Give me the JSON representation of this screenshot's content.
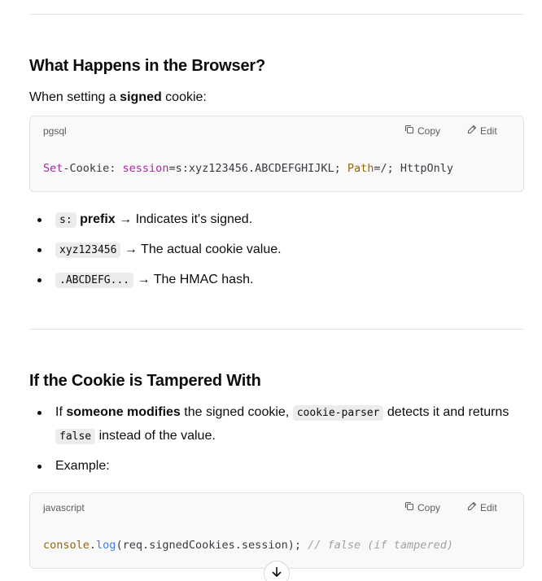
{
  "section1": {
    "heading": "What Happens in the Browser?",
    "intro_pre": "When setting a ",
    "intro_bold": "signed",
    "intro_post": " cookie:",
    "code": {
      "lang": "pgsql",
      "copy_label": "Copy",
      "edit_label": "Edit",
      "line": {
        "t1": "Set",
        "t2": "-Cookie: ",
        "t3": "session",
        "t4": "=s:xyz123456.ABCDEFGHIJKL; ",
        "t5": "Path",
        "t6": "=/; HttpOnly"
      }
    },
    "bullets": [
      {
        "code": "s:",
        "bold": " prefix",
        "text": " → Indicates it's signed."
      },
      {
        "code": "xyz123456",
        "text": " → The actual cookie value."
      },
      {
        "code": ".ABCDEFG...",
        "text": " → The HMAC hash."
      }
    ]
  },
  "section2": {
    "heading": "If the Cookie is Tampered With",
    "bullet1": {
      "pre": "If ",
      "bold": "someone modifies",
      "mid": " the signed cookie, ",
      "code1": "cookie-parser",
      "post": " detects it and returns",
      "code2": "false",
      "end": " instead of the value."
    },
    "bullet2": "Example:",
    "code": {
      "lang": "javascript",
      "copy_label": "Copy",
      "edit_label": "Edit",
      "line": {
        "t1": "console",
        "t2": ".",
        "t3": "log",
        "t4": "(req.signedCookies.session); ",
        "t5": "// false (if tampered)"
      }
    }
  },
  "icons": {
    "copy": "copy-icon",
    "edit": "edit-pencil-icon",
    "scroll": "arrow-down-icon"
  }
}
